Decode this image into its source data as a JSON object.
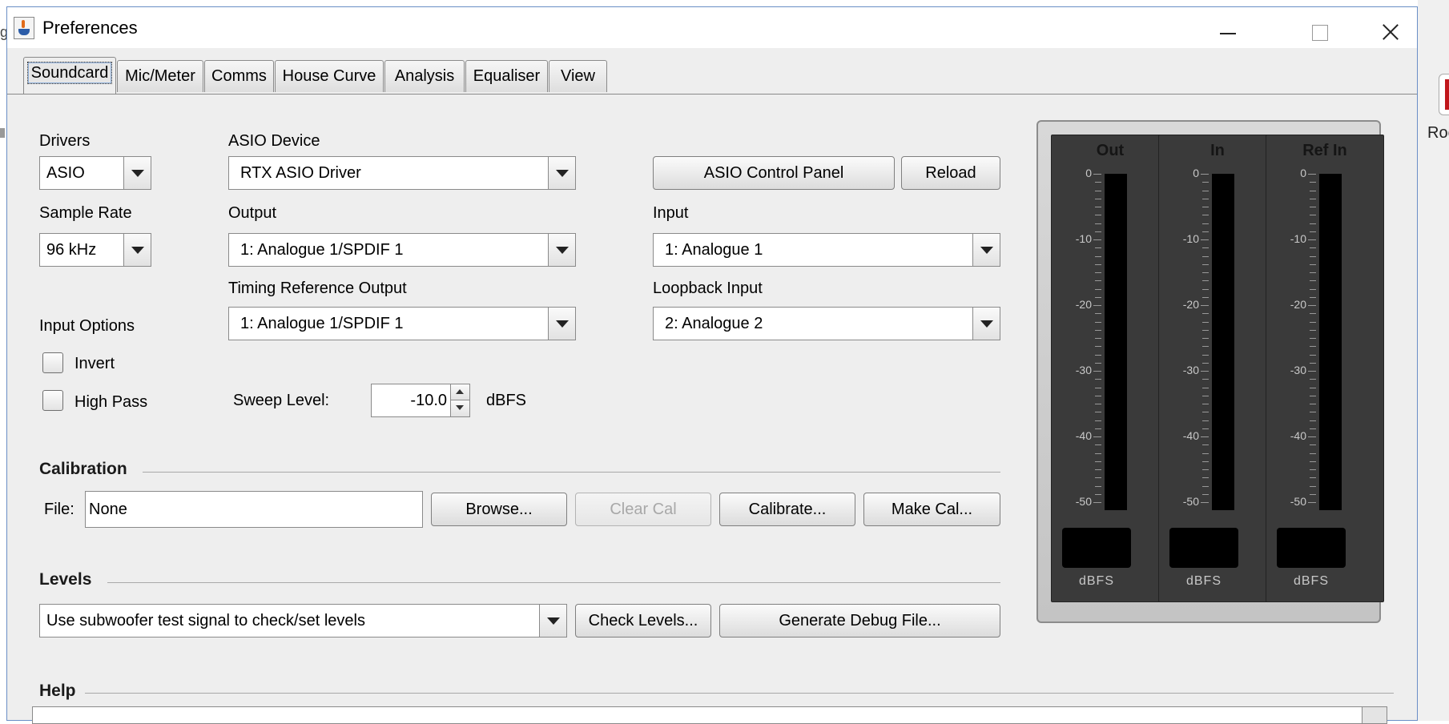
{
  "window": {
    "title": "Preferences",
    "background_fragment": "Roc"
  },
  "tabs": [
    {
      "label": "Soundcard",
      "active": true
    },
    {
      "label": "Mic/Meter",
      "active": false
    },
    {
      "label": "Comms",
      "active": false
    },
    {
      "label": "House Curve",
      "active": false
    },
    {
      "label": "Analysis",
      "active": false
    },
    {
      "label": "Equaliser",
      "active": false
    },
    {
      "label": "View",
      "active": false
    }
  ],
  "soundcard": {
    "drivers": {
      "label": "Drivers",
      "value": "ASIO"
    },
    "asio_device": {
      "label": "ASIO Device",
      "value": "RTX ASIO Driver"
    },
    "asio_control_panel_label": "ASIO Control Panel",
    "reload_label": "Reload",
    "sample_rate": {
      "label": "Sample Rate",
      "value": "96 kHz"
    },
    "output": {
      "label": "Output",
      "value": "1: Analogue 1/SPDIF 1"
    },
    "input": {
      "label": "Input",
      "value": "1: Analogue 1"
    },
    "timing_ref_output": {
      "label": "Timing Reference Output",
      "value": "1: Analogue 1/SPDIF 1"
    },
    "loopback_input": {
      "label": "Loopback Input",
      "value": "2: Analogue 2"
    },
    "input_options": {
      "label": "Input Options",
      "invert": {
        "label": "Invert",
        "checked": false
      },
      "high_pass": {
        "label": "High Pass",
        "checked": false
      }
    },
    "sweep_level": {
      "label": "Sweep Level:",
      "value": "-10.0",
      "unit": "dBFS"
    }
  },
  "calibration": {
    "title": "Calibration",
    "file_label": "File:",
    "file_value": "None",
    "browse_label": "Browse...",
    "clear_cal_label": "Clear Cal",
    "calibrate_label": "Calibrate...",
    "make_cal_label": "Make Cal..."
  },
  "levels": {
    "title": "Levels",
    "select_value": "Use subwoofer test signal to check/set levels",
    "check_levels_label": "Check Levels...",
    "generate_debug_label": "Generate Debug File..."
  },
  "help": {
    "title": "Help"
  },
  "meters": {
    "ticks": [
      "0",
      "-10",
      "-20",
      "-30",
      "-40",
      "-50"
    ],
    "unit": "dBFS",
    "items": [
      {
        "name": "Out"
      },
      {
        "name": "In"
      },
      {
        "name": "Ref In"
      }
    ]
  },
  "colors": {
    "window_border": "#6a8ec6",
    "panel_bg": "#eeeeee",
    "meter_bg": "#3a3a3a"
  }
}
